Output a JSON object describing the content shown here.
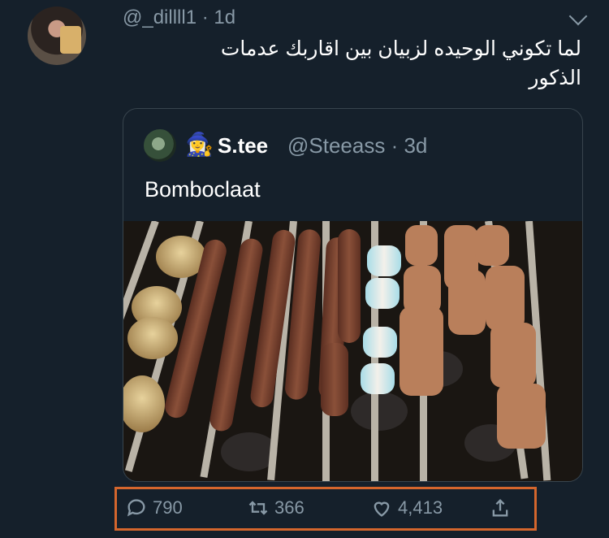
{
  "tweet": {
    "handle_line": "@_dillll1 · 1d",
    "text_line1": "لما تكوني الوحيده لزبيان بين اقاربك عدمات",
    "text_line2": "الذكور"
  },
  "quote": {
    "emoji": "🧙‍♀️",
    "name": "S.tee",
    "handle_line": "@Steeass · 3d",
    "body": "Bomboclaat"
  },
  "actions": {
    "reply_count": "790",
    "retweet_count": "366",
    "like_count": "4,413"
  },
  "icons": [
    "reply-icon",
    "retweet-icon",
    "like-icon",
    "share-icon",
    "chevron-down-icon"
  ],
  "colors": {
    "background": "#15202b",
    "secondary_text": "#8899a6",
    "highlight_box": "#d4662d"
  }
}
